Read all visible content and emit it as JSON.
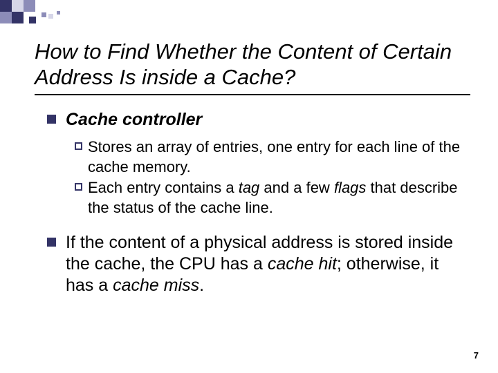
{
  "title": "How to Find Whether the Content of Certain Address Is inside a Cache?",
  "point1": {
    "head": "Cache controller",
    "sub1": {
      "a": "Stores",
      "b": " an array of entries, one entry for each line of the cache memory."
    },
    "sub2": {
      "a": "Each",
      "b": " entry contains a ",
      "c": "tag",
      "d": " and a few ",
      "e": "flags",
      "f": " that describe the status of the cache line."
    }
  },
  "point2": {
    "a": "If the content of a physical address is stored inside the cache, the CPU has a ",
    "b": "cache hit",
    "c": "; otherwise, it has a ",
    "d": "cache miss",
    "e": "."
  },
  "page": "7"
}
